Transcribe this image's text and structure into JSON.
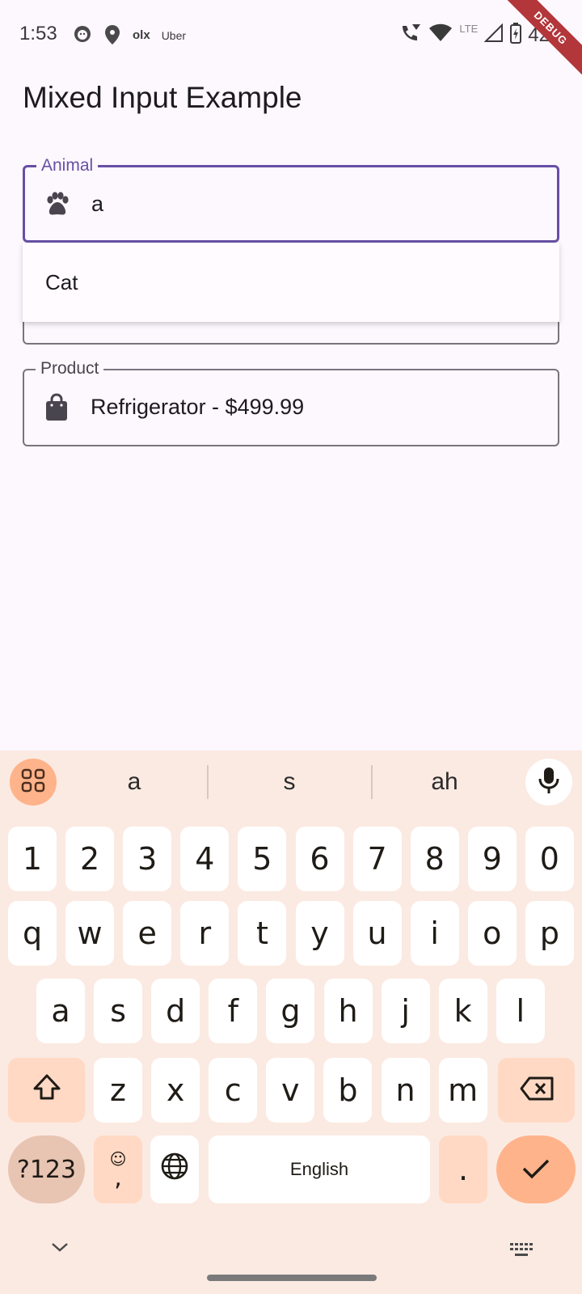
{
  "status_bar": {
    "time": "1:53",
    "left_icons": [
      "emoji-face-icon",
      "location-pin-icon",
      "olx-icon",
      "uber-icon"
    ],
    "olx_label": "olx",
    "uber_label": "Uber",
    "network_label": "LTE",
    "battery": "42",
    "debug_banner": "DEBUG"
  },
  "app_bar": {
    "title": "Mixed Input Example"
  },
  "form": {
    "animal": {
      "label": "Animal",
      "value": "a",
      "icon": "paw-icon"
    },
    "product": {
      "label": "Product",
      "value": "Refrigerator - $499.99",
      "icon": "shopping-bag-icon"
    }
  },
  "autocomplete": {
    "options": [
      {
        "label": "Cat"
      }
    ]
  },
  "keyboard": {
    "suggestions": [
      "a",
      "s",
      "ah"
    ],
    "row_numbers": [
      "1",
      "2",
      "3",
      "4",
      "5",
      "6",
      "7",
      "8",
      "9",
      "0"
    ],
    "row_1": [
      "q",
      "w",
      "e",
      "r",
      "t",
      "y",
      "u",
      "i",
      "o",
      "p"
    ],
    "row_2": [
      "a",
      "s",
      "d",
      "f",
      "g",
      "h",
      "j",
      "k",
      "l"
    ],
    "row_3": [
      "z",
      "x",
      "c",
      "v",
      "b",
      "n",
      "m"
    ],
    "symbols_label": "?123",
    "emoji_comma": ",",
    "space_label": "English",
    "period_label": ".",
    "colors": {
      "background": "#fbeae2",
      "accent": "#ffb38a",
      "function_key": "#ffd9c4"
    }
  }
}
